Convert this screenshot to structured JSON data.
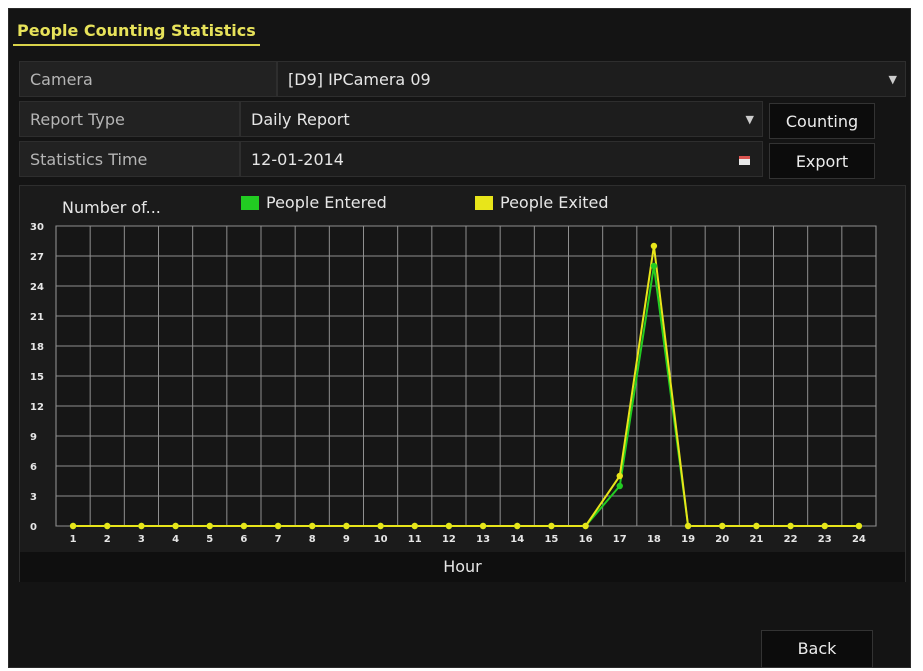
{
  "tab": {
    "label": "People Counting Statistics"
  },
  "camera": {
    "label": "Camera",
    "value": "[D9] IPCamera 09"
  },
  "report_type": {
    "label": "Report Type",
    "value": "Daily Report"
  },
  "statistics_time": {
    "label": "Statistics Time",
    "value": "12-01-2014"
  },
  "buttons": {
    "counting": "Counting",
    "export": "Export",
    "back": "Back"
  },
  "colors": {
    "entered": "#22cc22",
    "exited": "#e8e51a",
    "accent": "#e7e25a"
  },
  "chart_data": {
    "type": "line",
    "ylabel": "Number of...",
    "xlabel": "Hour",
    "categories": [
      "1",
      "2",
      "3",
      "4",
      "5",
      "6",
      "7",
      "8",
      "9",
      "10",
      "11",
      "12",
      "13",
      "14",
      "15",
      "16",
      "17",
      "18",
      "19",
      "20",
      "21",
      "22",
      "23",
      "24"
    ],
    "yticks": [
      0,
      3,
      6,
      9,
      12,
      15,
      18,
      21,
      24,
      27,
      30
    ],
    "ylim": [
      0,
      30
    ],
    "grid": true,
    "legend_position": "top",
    "series": [
      {
        "name": "People Entered",
        "values": [
          0,
          0,
          0,
          0,
          0,
          0,
          0,
          0,
          0,
          0,
          0,
          0,
          0,
          0,
          0,
          0,
          4,
          26,
          0,
          0,
          0,
          0,
          0,
          0
        ]
      },
      {
        "name": "People Exited",
        "values": [
          0,
          0,
          0,
          0,
          0,
          0,
          0,
          0,
          0,
          0,
          0,
          0,
          0,
          0,
          0,
          0,
          5,
          28,
          0,
          0,
          0,
          0,
          0,
          0
        ]
      }
    ]
  }
}
